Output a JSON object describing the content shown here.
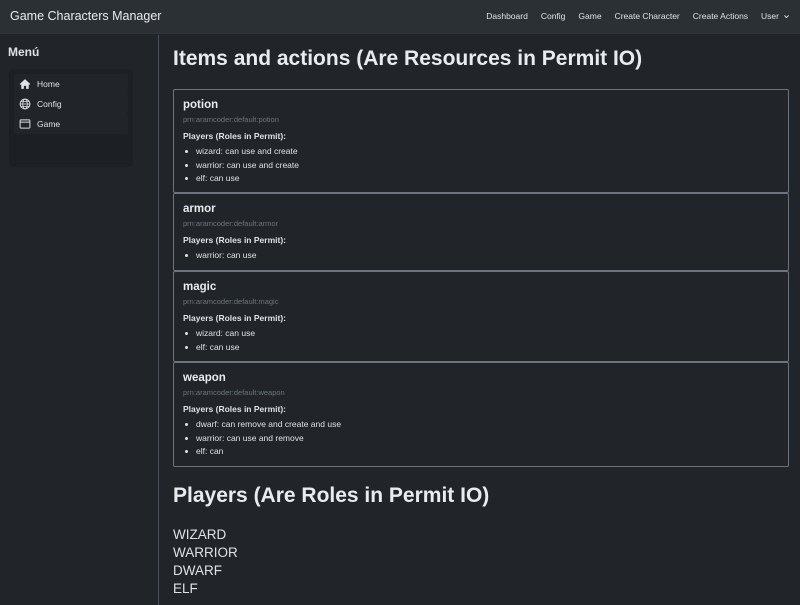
{
  "navbar": {
    "brand": "Game Characters Manager",
    "links": [
      "Dashboard",
      "Config",
      "Game",
      "Create Character",
      "Create Actions"
    ],
    "user_label": "User"
  },
  "sidebar": {
    "title": "Menú",
    "items": [
      {
        "label": "Home",
        "icon": "home-icon"
      },
      {
        "label": "Config",
        "icon": "globe-icon"
      },
      {
        "label": "Game",
        "icon": "window-icon"
      }
    ]
  },
  "main": {
    "items_heading": "Items and actions (Are Resources in Permit IO)",
    "resources": [
      {
        "name": "potion",
        "prn": "prn:aramcoder:default:potion",
        "roles_heading": "Players (Roles in Permit):",
        "permissions": [
          "wizard: can use and create",
          "warrior: can use and create",
          "elf: can use"
        ]
      },
      {
        "name": "armor",
        "prn": "prn:aramcoder:default:armor",
        "roles_heading": "Players (Roles in Permit):",
        "permissions": [
          "warrior: can use"
        ]
      },
      {
        "name": "magic",
        "prn": "prn:aramcoder:default:magic",
        "roles_heading": "Players (Roles in Permit):",
        "permissions": [
          "wizard: can use",
          "elf: can use"
        ]
      },
      {
        "name": "weapon",
        "prn": "prn:aramcoder:default:weapon",
        "roles_heading": "Players (Roles in Permit):",
        "permissions": [
          "dwarf: can remove and create and use",
          "warrior: can use and remove",
          "elf: can"
        ]
      }
    ],
    "players_heading": "Players (Are Roles in Permit IO)",
    "players": [
      "WIZARD",
      "WARRIOR",
      "DWARF",
      "ELF"
    ]
  }
}
